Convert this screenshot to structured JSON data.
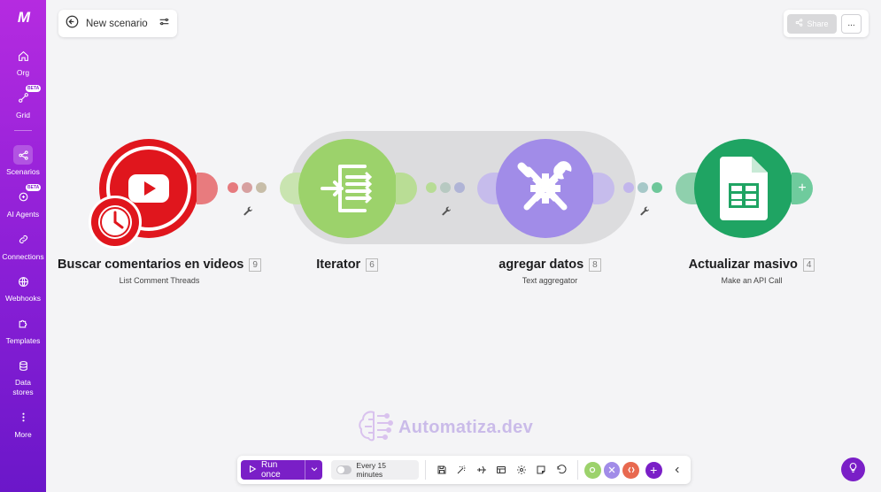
{
  "sidebar": {
    "logo": "M",
    "items": [
      {
        "label": "Org",
        "icon": "home-icon"
      },
      {
        "label": "Grid",
        "icon": "grid-icon",
        "badge": "BETA"
      },
      {
        "label": "Scenarios",
        "icon": "share-nodes-icon",
        "active": true
      },
      {
        "label": "AI Agents",
        "icon": "ai-agent-icon",
        "badge": "BETA"
      },
      {
        "label": "Connections",
        "icon": "link-icon"
      },
      {
        "label": "Webhooks",
        "icon": "globe-icon"
      },
      {
        "label": "Templates",
        "icon": "puzzle-icon"
      },
      {
        "label": "Data stores",
        "icon": "database-icon"
      },
      {
        "label": "More",
        "icon": "more-vertical-icon"
      }
    ]
  },
  "header": {
    "scenario_name": "New scenario",
    "share_label": "Share",
    "more_label": "..."
  },
  "modules": [
    {
      "title": "Buscar comentarios en videos",
      "number": "9",
      "subtitle": "List Comment Threads",
      "app": "YouTube",
      "color": "#e0161d"
    },
    {
      "title": "Iterator",
      "number": "6",
      "subtitle": "",
      "app": "Flow Control",
      "color": "#9cd26b"
    },
    {
      "title": "agregar datos",
      "number": "8",
      "subtitle": "Text aggregator",
      "app": "Tools",
      "color": "#a18ce8"
    },
    {
      "title": "Actualizar masivo",
      "number": "4",
      "subtitle": "Make an API Call",
      "app": "Google Sheets",
      "color": "#1fa463"
    }
  ],
  "watermark": {
    "text": "Automatiza.dev"
  },
  "toolbar": {
    "run_label": "Run once",
    "schedule_label": "Every 15 minutes",
    "add_label": "+",
    "collapse_label": "<"
  }
}
